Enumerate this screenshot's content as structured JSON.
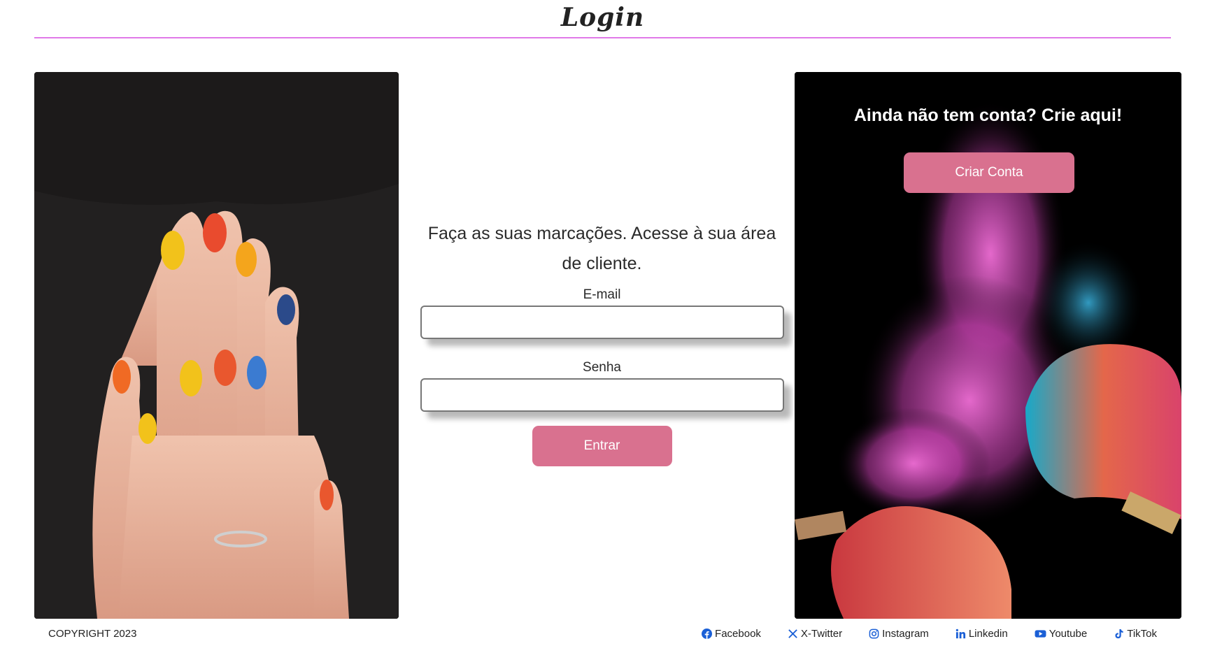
{
  "header": {
    "title": "Login"
  },
  "left_image": {
    "alt": "nail-art-hands-image"
  },
  "form": {
    "intro": "Faça as suas marcações. Acesse à sua área de cliente.",
    "email_label": "E-mail",
    "email_value": "",
    "password_label": "Senha",
    "password_value": "",
    "submit_label": "Entrar"
  },
  "signup": {
    "title": "Ainda não tem conta? Crie aqui!",
    "button_label": "Criar Conta"
  },
  "footer": {
    "copyright": "COPYRIGHT 2023",
    "social": [
      {
        "label": "Facebook",
        "icon": "facebook-icon"
      },
      {
        "label": "X-Twitter",
        "icon": "x-twitter-icon"
      },
      {
        "label": "Instagram",
        "icon": "instagram-icon"
      },
      {
        "label": "Linkedin",
        "icon": "linkedin-icon"
      },
      {
        "label": "Youtube",
        "icon": "youtube-icon"
      },
      {
        "label": "TikTok",
        "icon": "tiktok-icon"
      }
    ]
  },
  "colors": {
    "accent": "#d9718f",
    "header_line": "#e07ae8",
    "social_icon": "#1a5fd6"
  }
}
